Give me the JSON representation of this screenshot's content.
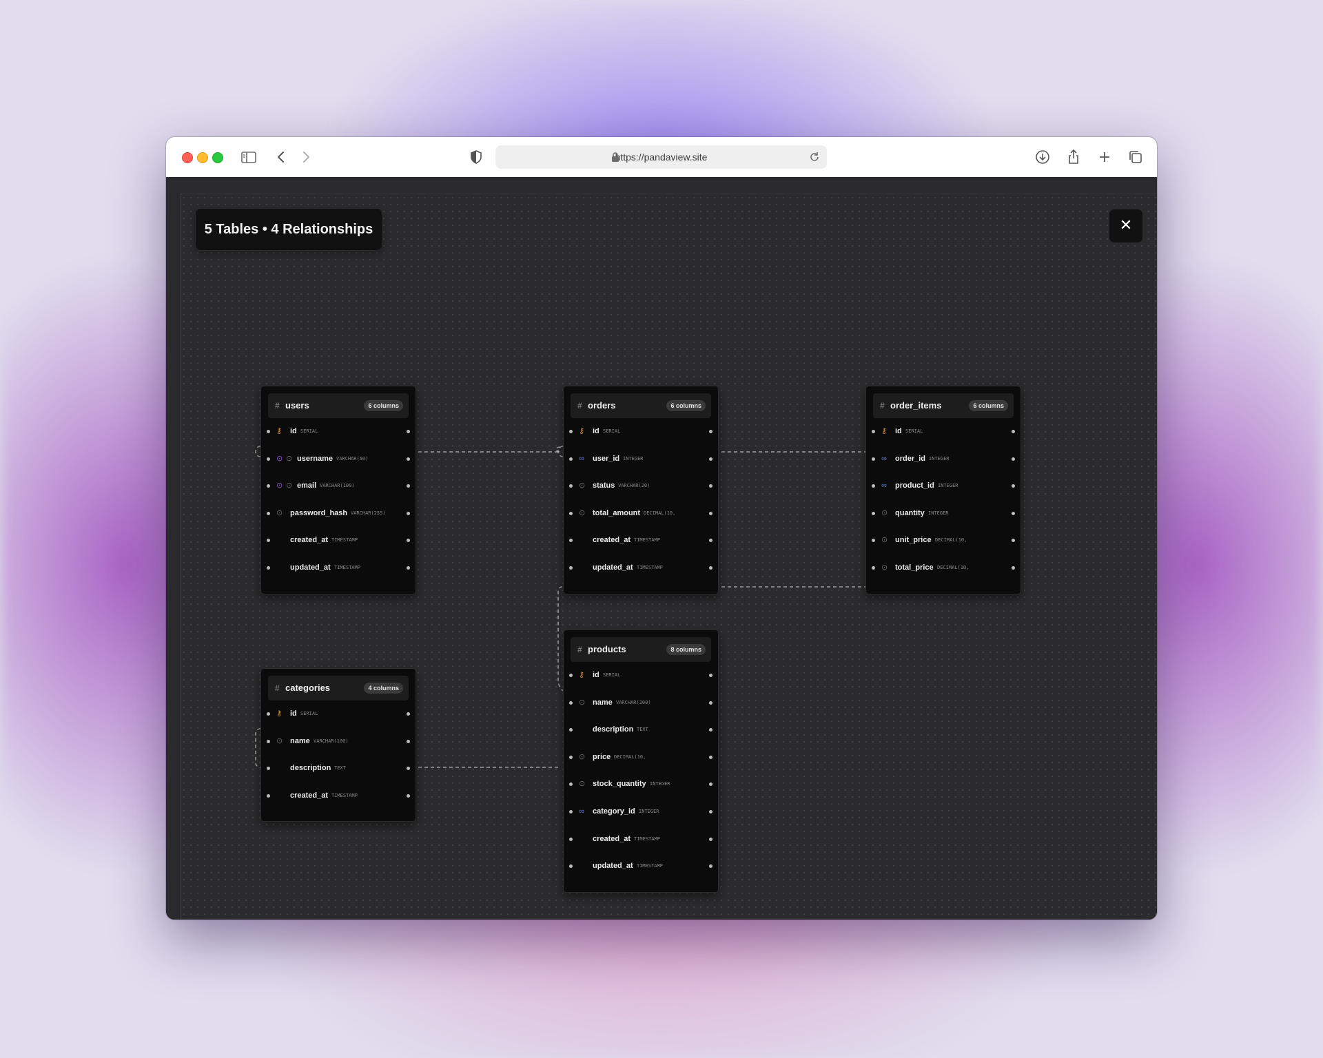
{
  "browser": {
    "url": "https://pandaview.site",
    "icons": [
      "sidebar-icon",
      "back-icon",
      "forward-icon",
      "shield-icon",
      "lock-icon",
      "reload-icon",
      "download-icon",
      "share-icon",
      "new-tab-icon",
      "tabs-overview-icon"
    ]
  },
  "diagram": {
    "summary": "5 Tables • 4 Relationships",
    "close_label": "✕",
    "tables": [
      {
        "id": "users",
        "name": "users",
        "count": "6 columns",
        "columns": [
          {
            "name": "id",
            "type": "SERIAL",
            "icons": [
              "pk"
            ]
          },
          {
            "name": "username",
            "type": "VARCHAR(50)",
            "icons": [
              "uq",
              "idx"
            ]
          },
          {
            "name": "email",
            "type": "VARCHAR(100)",
            "icons": [
              "uq",
              "idx"
            ]
          },
          {
            "name": "password_hash",
            "type": "VARCHAR(255)",
            "icons": [
              "idx"
            ]
          },
          {
            "name": "created_at",
            "type": "TIMESTAMP",
            "icons": []
          },
          {
            "name": "updated_at",
            "type": "TIMESTAMP",
            "icons": []
          }
        ]
      },
      {
        "id": "orders",
        "name": "orders",
        "count": "6 columns",
        "columns": [
          {
            "name": "id",
            "type": "SERIAL",
            "icons": [
              "pk"
            ]
          },
          {
            "name": "user_id",
            "type": "INTEGER",
            "icons": [
              "fk"
            ]
          },
          {
            "name": "status",
            "type": "VARCHAR(20)",
            "icons": [
              "idx"
            ]
          },
          {
            "name": "total_amount",
            "type": "DECIMAL(10,",
            "icons": [
              "idx"
            ]
          },
          {
            "name": "created_at",
            "type": "TIMESTAMP",
            "icons": []
          },
          {
            "name": "updated_at",
            "type": "TIMESTAMP",
            "icons": []
          }
        ]
      },
      {
        "id": "order_items",
        "name": "order_items",
        "count": "6 columns",
        "columns": [
          {
            "name": "id",
            "type": "SERIAL",
            "icons": [
              "pk"
            ]
          },
          {
            "name": "order_id",
            "type": "INTEGER",
            "icons": [
              "fk"
            ]
          },
          {
            "name": "product_id",
            "type": "INTEGER",
            "icons": [
              "fk"
            ]
          },
          {
            "name": "quantity",
            "type": "INTEGER",
            "icons": [
              "idx"
            ]
          },
          {
            "name": "unit_price",
            "type": "DECIMAL(10,",
            "icons": [
              "idx"
            ]
          },
          {
            "name": "total_price",
            "type": "DECIMAL(10,",
            "icons": [
              "idx"
            ]
          }
        ]
      },
      {
        "id": "products",
        "name": "products",
        "count": "8 columns",
        "columns": [
          {
            "name": "id",
            "type": "SERIAL",
            "icons": [
              "pk"
            ]
          },
          {
            "name": "name",
            "type": "VARCHAR(200)",
            "icons": [
              "idx"
            ]
          },
          {
            "name": "description",
            "type": "TEXT",
            "icons": []
          },
          {
            "name": "price",
            "type": "DECIMAL(10,",
            "icons": [
              "idx"
            ]
          },
          {
            "name": "stock_quantity",
            "type": "INTEGER",
            "icons": [
              "idx"
            ]
          },
          {
            "name": "category_id",
            "type": "INTEGER",
            "icons": [
              "fk"
            ]
          },
          {
            "name": "created_at",
            "type": "TIMESTAMP",
            "icons": []
          },
          {
            "name": "updated_at",
            "type": "TIMESTAMP",
            "icons": []
          }
        ]
      },
      {
        "id": "categories",
        "name": "categories",
        "count": "4 columns",
        "columns": [
          {
            "name": "id",
            "type": "SERIAL",
            "icons": [
              "pk"
            ]
          },
          {
            "name": "name",
            "type": "VARCHAR(100)",
            "icons": [
              "idx"
            ]
          },
          {
            "name": "description",
            "type": "TEXT",
            "icons": []
          },
          {
            "name": "created_at",
            "type": "TIMESTAMP",
            "icons": []
          }
        ]
      }
    ]
  }
}
